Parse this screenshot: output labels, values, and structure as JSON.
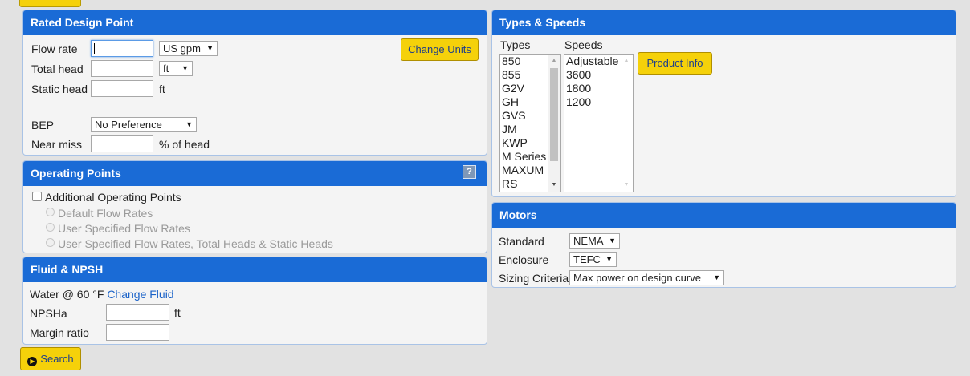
{
  "rated_design_point": {
    "title": "Rated Design Point",
    "flow_rate_label": "Flow rate",
    "flow_rate_value": "",
    "flow_unit": "US gpm",
    "total_head_label": "Total head",
    "total_head_value": "",
    "head_unit": "ft",
    "static_head_label": "Static head",
    "static_head_value": "",
    "static_head_unit": "ft",
    "bep_label": "BEP",
    "bep_value": "No Preference",
    "near_miss_label": "Near miss",
    "near_miss_value": "",
    "near_miss_unit": "% of head",
    "change_units_label": "Change Units"
  },
  "operating_points": {
    "title": "Operating Points",
    "help_label": "?",
    "additional_label": "Additional Operating Points",
    "options": [
      "Default Flow Rates",
      "User Specified Flow Rates",
      "User Specified Flow Rates, Total Heads & Static Heads"
    ]
  },
  "fluid_npsh": {
    "title": "Fluid & NPSH",
    "fluid_text": "Water @ 60 °F",
    "change_fluid_label": "Change Fluid",
    "npsha_label": "NPSHa",
    "npsha_value": "",
    "npsha_unit": "ft",
    "margin_label": "Margin ratio",
    "margin_value": ""
  },
  "search_button_label": "Search",
  "types_speeds": {
    "title": "Types & Speeds",
    "types_label": "Types",
    "speeds_label": "Speeds",
    "types": [
      "850",
      "855",
      "G2V",
      "GH",
      "GVS",
      "JM",
      "KWP",
      "M Series",
      "MAXUM",
      "RS"
    ],
    "speeds": [
      "Adjustable",
      "3600",
      "1800",
      "1200"
    ],
    "product_info_label": "Product Info"
  },
  "motors": {
    "title": "Motors",
    "standard_label": "Standard",
    "standard_value": "NEMA",
    "enclosure_label": "Enclosure",
    "enclosure_value": "TEFC",
    "sizing_label": "Sizing Criteria",
    "sizing_value": "Max power on design curve"
  },
  "colors": {
    "header_blue": "#1a6bd6",
    "button_yellow": "#f5d10a",
    "link_blue": "#1a62c8"
  }
}
